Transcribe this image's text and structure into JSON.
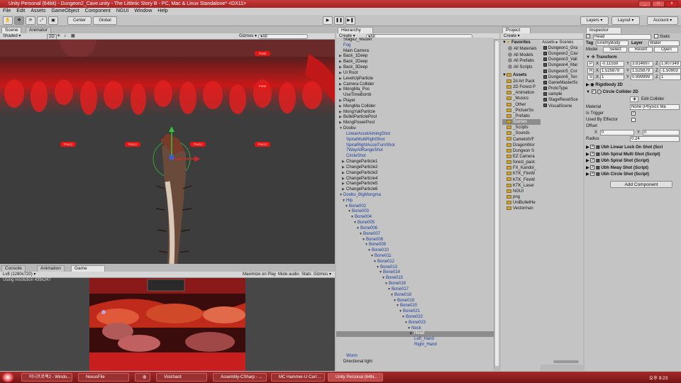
{
  "window": {
    "title": "Unity Personal (64bit) - Dungeon2_Cave.unity - The Littletic Story B - PC, Mac & Linux Standalone* <DX11>"
  },
  "menu": [
    "File",
    "Edit",
    "Assets",
    "GameObject",
    "Component",
    "NGUI",
    "Window",
    "Help"
  ],
  "toolbar": {
    "center": "Center",
    "global": "Global",
    "layers": "Layers",
    "layout": "Layout",
    "account": "Account"
  },
  "scene": {
    "tabs": [
      "Scene",
      "Animator"
    ],
    "shading": "Shaded",
    "mode2d": "2D",
    "gizmos": "Gizmos",
    "search": "▾All",
    "markers": [
      "Pos8",
      "Pos9",
      "Pos12",
      "Pos11",
      "Pos11",
      "Pos10"
    ]
  },
  "game": {
    "tabs": [
      "Console",
      "Animation",
      "Game"
    ],
    "resolution_select": "Lv8 (1280x720)",
    "maximize": "Maximize on Play",
    "mute": "Mute audio",
    "stats": "Stats",
    "gizmos": "Gizmos",
    "resolution_text": "Using resolution 439x247"
  },
  "hierarchy": {
    "tab": "Hierarchy",
    "create": "Create",
    "search": "▾All",
    "items": [
      {
        "label": "Stage2_Master",
        "indent": 0,
        "arrow": "",
        "blue": false
      },
      {
        "label": "Fog",
        "indent": 0,
        "arrow": "",
        "blue": true
      },
      {
        "label": "Main Camera",
        "indent": 0,
        "arrow": "",
        "blue": false
      },
      {
        "label": "Back_1Deep",
        "indent": 0,
        "arrow": "▶",
        "blue": false
      },
      {
        "label": "Back_2Deep",
        "indent": 0,
        "arrow": "▶",
        "blue": false
      },
      {
        "label": "Back_3Deep",
        "indent": 0,
        "arrow": "▶",
        "blue": false
      },
      {
        "label": "UI Root",
        "indent": 0,
        "arrow": "▶",
        "blue": false
      },
      {
        "label": "LevelUpParticle",
        "indent": 0,
        "arrow": "▶",
        "blue": false
      },
      {
        "label": "Camera Collider",
        "indent": 0,
        "arrow": "▶",
        "blue": false
      },
      {
        "label": "MongMa_Pos",
        "indent": 0,
        "arrow": "▶",
        "blue": false
      },
      {
        "label": "UseTimeBomb",
        "indent": 0,
        "arrow": "",
        "blue": false
      },
      {
        "label": "Player",
        "indent": 0,
        "arrow": "▶",
        "blue": false
      },
      {
        "label": "MongMa Collider",
        "indent": 0,
        "arrow": "▶",
        "blue": false
      },
      {
        "label": "MongYakParticle",
        "indent": 0,
        "arrow": "▶",
        "blue": false
      },
      {
        "label": "BulletParticlePool",
        "indent": 0,
        "arrow": "▶",
        "blue": false
      },
      {
        "label": "MongPowerPool",
        "indent": 0,
        "arrow": "▶",
        "blue": false
      },
      {
        "label": "Doobu",
        "indent": 0,
        "arrow": "▼",
        "blue": false
      },
      {
        "label": "LinearAccelAimingShot",
        "indent": 1,
        "arrow": "",
        "blue": true
      },
      {
        "label": "SpiralMultiRightShot",
        "indent": 1,
        "arrow": "",
        "blue": true
      },
      {
        "label": "SpiralRightAccelTurnShot",
        "indent": 1,
        "arrow": "",
        "blue": true
      },
      {
        "label": "7WayAllRangeShot",
        "indent": 1,
        "arrow": "",
        "blue": true
      },
      {
        "label": "CircleShot",
        "indent": 1,
        "arrow": "",
        "blue": true
      },
      {
        "label": "ChangeParticle1",
        "indent": 1,
        "arrow": "▶",
        "blue": false
      },
      {
        "label": "ChangeParticle2",
        "indent": 1,
        "arrow": "▶",
        "blue": false
      },
      {
        "label": "ChangeParticle3",
        "indent": 1,
        "arrow": "▶",
        "blue": false
      },
      {
        "label": "ChangeParticle4",
        "indent": 1,
        "arrow": "▶",
        "blue": false
      },
      {
        "label": "ChangeParticle5",
        "indent": 1,
        "arrow": "▶",
        "blue": false
      },
      {
        "label": "ChangeParticle6",
        "indent": 1,
        "arrow": "▶",
        "blue": false
      },
      {
        "label": "Doobu_BigMongma",
        "indent": 0,
        "arrow": "▼",
        "blue": true
      },
      {
        "label": "Hip",
        "indent": 1,
        "arrow": "▼",
        "blue": true
      },
      {
        "label": "Bone002",
        "indent": 2,
        "arrow": "▼",
        "blue": true
      },
      {
        "label": "Bone003",
        "indent": 3,
        "arrow": "▼",
        "blue": true
      },
      {
        "label": "Bone004",
        "indent": 4,
        "arrow": "▼",
        "blue": true
      },
      {
        "label": "Bone005",
        "indent": 5,
        "arrow": "▼",
        "blue": true
      },
      {
        "label": "Bone006",
        "indent": 6,
        "arrow": "▼",
        "blue": true
      },
      {
        "label": "Bone007",
        "indent": 7,
        "arrow": "▼",
        "blue": true
      },
      {
        "label": "Bone008",
        "indent": 8,
        "arrow": "▼",
        "blue": true
      },
      {
        "label": "Bone009",
        "indent": 9,
        "arrow": "▼",
        "blue": true
      },
      {
        "label": "Bone010",
        "indent": 10,
        "arrow": "▼",
        "blue": true
      },
      {
        "label": "Bone011",
        "indent": 11,
        "arrow": "▼",
        "blue": true
      },
      {
        "label": "Bone012",
        "indent": 12,
        "arrow": "▼",
        "blue": true
      },
      {
        "label": "Bone013",
        "indent": 13,
        "arrow": "▼",
        "blue": true
      },
      {
        "label": "Bone014",
        "indent": 14,
        "arrow": "▼",
        "blue": true
      },
      {
        "label": "Bone015",
        "indent": 15,
        "arrow": "▼",
        "blue": true
      },
      {
        "label": "Bone016",
        "indent": 16,
        "arrow": "▼",
        "blue": true
      },
      {
        "label": "Bone017",
        "indent": 17,
        "arrow": "▼",
        "blue": true
      },
      {
        "label": "Bone018",
        "indent": 18,
        "arrow": "▼",
        "blue": true
      },
      {
        "label": "Bone019",
        "indent": 19,
        "arrow": "▼",
        "blue": true
      },
      {
        "label": "Bone020",
        "indent": 20,
        "arrow": "▼",
        "blue": true
      },
      {
        "label": "Bone021",
        "indent": 21,
        "arrow": "▼",
        "blue": true
      },
      {
        "label": "Bone022",
        "indent": 22,
        "arrow": "▼",
        "blue": true
      },
      {
        "label": "Bone023",
        "indent": 23,
        "arrow": "▼",
        "blue": true
      },
      {
        "label": "Neck",
        "indent": 24,
        "arrow": "▼",
        "blue": true
      },
      {
        "label": "Head",
        "indent": 25,
        "arrow": "▶",
        "blue": false,
        "selected": true
      },
      {
        "label": "Left_Hand",
        "indent": 25,
        "arrow": "",
        "blue": true
      },
      {
        "label": "Right_Hand",
        "indent": 25,
        "arrow": "",
        "blue": true
      },
      {
        "label": "",
        "indent": 0,
        "arrow": "",
        "blue": false
      },
      {
        "label": "Worm",
        "indent": 1,
        "arrow": "",
        "blue": true
      },
      {
        "label": "Directional light",
        "indent": 0,
        "arrow": "",
        "blue": false
      }
    ]
  },
  "project": {
    "tab": "Project",
    "create": "Create",
    "favorites_label": "Favorites",
    "favorites": [
      "All Materials",
      "All Models",
      "All Prefabs",
      "All Scripts"
    ],
    "assets_label": "Assets",
    "folders": [
      "2d Art Pack",
      "2D Forest P",
      "_Animation",
      "_Musics",
      "_Other",
      "_PictuerSo",
      "_Prefabs",
      "Scenes",
      "_Scripts",
      "_Sounds",
      "CamelotVF",
      "DragonWor",
      "Dungeon S",
      "EZ Camera",
      "forest_pack",
      "FX_Kandol_",
      "KTK_FireW",
      "KTK_FireW",
      "KTK_Laser",
      "NGUI",
      "png",
      "UniBulletHe",
      "Vectorman"
    ],
    "selected_folder": "Scenes",
    "breadcrumb": [
      "Assets",
      "Scenes"
    ],
    "scenes": [
      "Dungeon1_Gra",
      "Dungeon2_Cav",
      "Dungeon3_Vall",
      "Dungeon4_Mar",
      "Dungeon5_Cor",
      "Dungeon6_Ten",
      "GameMasterSc",
      "ProtoType",
      "sample",
      "StageResetSce",
      "VisualScene"
    ]
  },
  "inspector": {
    "tab": "Inspector",
    "object_name": "Head",
    "static_label": "Static",
    "tag_label": "Tag",
    "tag_value": "EnemyBody",
    "layer_label": "Layer",
    "layer_value": "Water",
    "model_label": "Model",
    "model_buttons": [
      "Select",
      "Revert",
      "Open"
    ],
    "transform_title": "Transform",
    "transform_rows": [
      {
        "key": "P",
        "x": "-0.11559",
        "y": "3.814697",
        "z": "1.907349"
      },
      {
        "key": "R",
        "x": "1.525879",
        "y": "1.525879",
        "z": "-1.50903"
      },
      {
        "key": "S",
        "x": "1",
        "y": "0.999999",
        "z": "1"
      }
    ],
    "rigidbody_title": "Rigidbody 2D",
    "collider_title": "Circle Collider 2D",
    "edit_collider": "Edit Collider",
    "material_label": "Material",
    "material_value": "None (Physics Ma",
    "is_trigger_label": "Is Trigger",
    "used_by_effector_label": "Used By Effector",
    "offset_label": "Offset",
    "offset_x": "0",
    "offset_y": "0",
    "radius_label": "Radius",
    "radius_value": "0.24",
    "scripts": [
      "Ubh Linear Lock On Shot (Scri",
      "Ubh Spiral Multi Shot (Script)",
      "Ubh Spiral Shot (Script)",
      "Ubh Nway Shot (Script)",
      "Ubh Circle Shot (Script)"
    ],
    "add_component": "Add Component"
  },
  "taskbar": {
    "items": [
      "미니프로젝2 - Windo...",
      "NexusFile",
      "",
      "Visichard",
      "Assembly-CSharp - ...",
      "MC Hammer-U Can'...",
      "Unity Personal (64bi..."
    ],
    "clock": "오후 9:23"
  },
  "colors": {
    "title": "#b52a2a",
    "selection": "#8c8c8c",
    "scene_bg": "#3a3a3a",
    "marker": "#e81515"
  }
}
